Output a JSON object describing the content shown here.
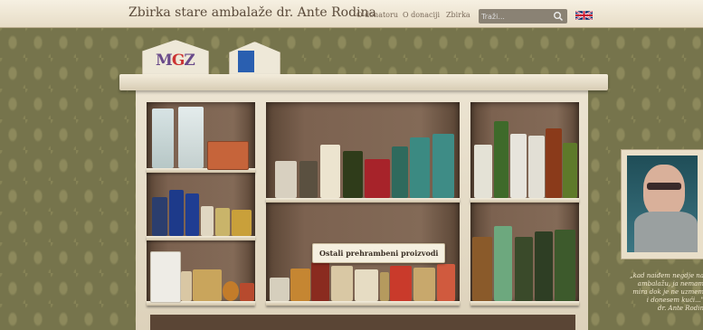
{
  "header": {
    "title": "Zbirka stare ambalaže dr. Ante Rodina",
    "nav": [
      "O donatoru",
      "O donaciji",
      "Zbirka"
    ],
    "search_placeholder": "Traži..."
  },
  "tooltip": "Ostali prehrambeni proizvodi",
  "quote": {
    "lines": [
      "„kad naiđem negdje na",
      "ambalažu, ja nemam",
      "mira dok je ne uzmem",
      "i donesem kući...\"",
      "dr. Ante Rodin"
    ]
  },
  "signs": {
    "left_logo": "MGZ"
  },
  "colors": {
    "header_bg": "#efe6d2",
    "wall": "#76744c",
    "cabinet": "#e6dcc7",
    "search_bg": "#8a8274"
  }
}
